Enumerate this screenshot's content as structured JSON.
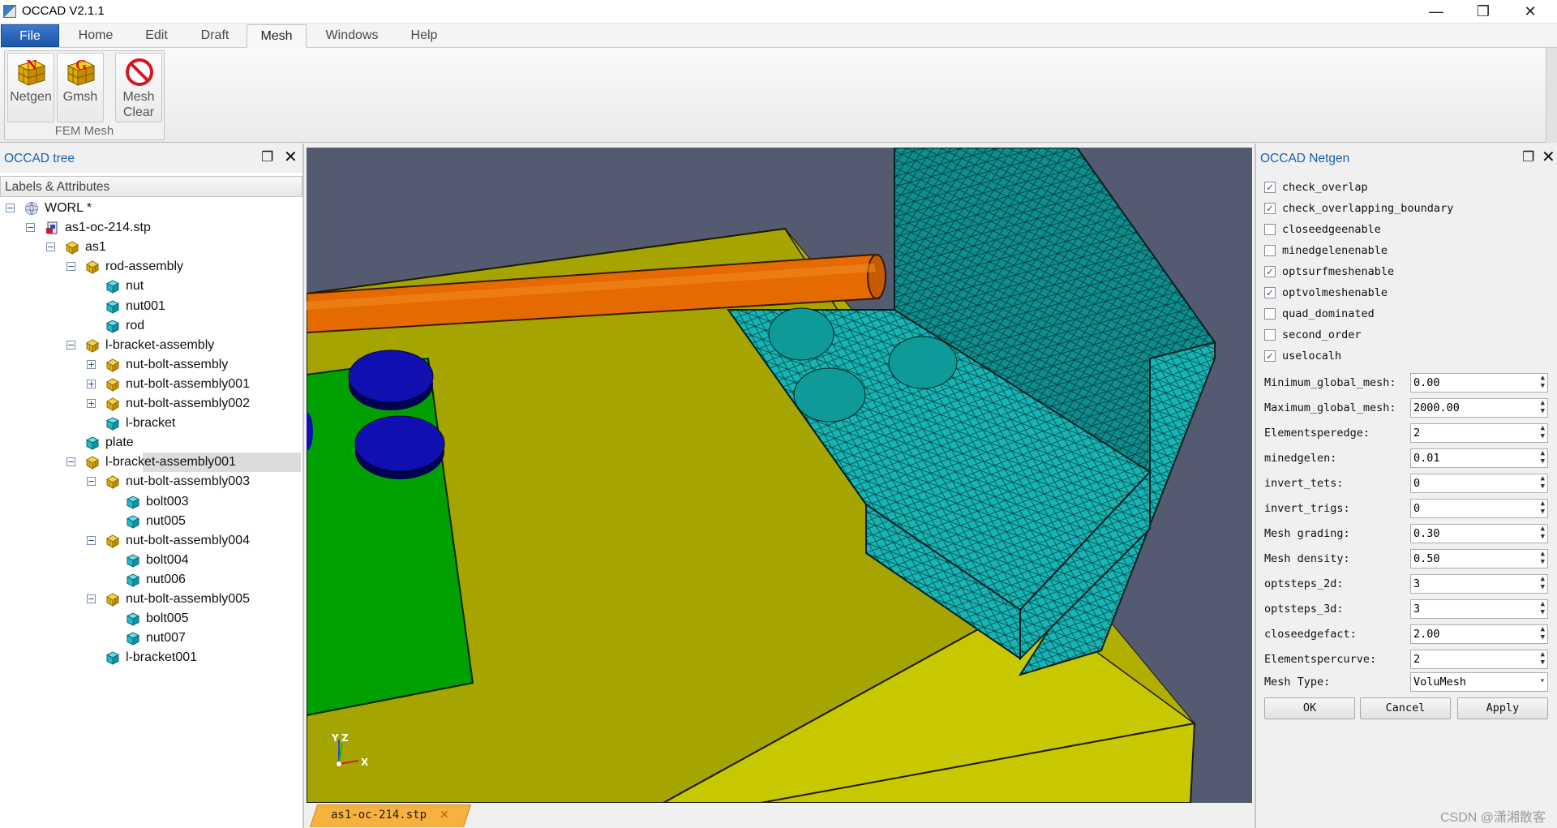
{
  "window": {
    "title": "OCCAD V2.1.1",
    "minimize": "—",
    "maximize": "❐",
    "close": "✕"
  },
  "menu": {
    "tabs": [
      "File",
      "Home",
      "Edit",
      "Draft",
      "Mesh",
      "Windows",
      "Help"
    ],
    "active": "Mesh",
    "collapse_glyph": "⌃"
  },
  "ribbon": {
    "group_label": "FEM Mesh",
    "buttons": [
      {
        "label": "Netgen",
        "icon": "netgen-icon"
      },
      {
        "label": "Gmsh",
        "icon": "gmsh-icon"
      },
      {
        "label": "Mesh\nClear",
        "icon": "mesh-clear-icon"
      }
    ]
  },
  "left_dock": {
    "title": "OCCAD tree",
    "header": "Labels & Attributes",
    "float_glyph": "❐",
    "close_glyph": "✕",
    "tree": [
      {
        "label": "WORL *",
        "level": 0,
        "toggle": "−",
        "icon": "world-icon"
      },
      {
        "label": "as1-oc-214.stp",
        "level": 1,
        "toggle": "−",
        "icon": "document-icon"
      },
      {
        "label": "as1",
        "level": 2,
        "toggle": "−",
        "icon": "assembly-icon"
      },
      {
        "label": "rod-assembly",
        "level": 3,
        "toggle": "−",
        "icon": "assembly-icon"
      },
      {
        "label": "nut",
        "level": 4,
        "toggle": "",
        "icon": "part-icon"
      },
      {
        "label": "nut001",
        "level": 4,
        "toggle": "",
        "icon": "part-icon"
      },
      {
        "label": "rod",
        "level": 4,
        "toggle": "",
        "icon": "part-icon"
      },
      {
        "label": "l-bracket-assembly",
        "level": 3,
        "toggle": "−",
        "icon": "assembly-icon"
      },
      {
        "label": "nut-bolt-assembly",
        "level": 4,
        "toggle": "+",
        "icon": "assembly-icon"
      },
      {
        "label": "nut-bolt-assembly001",
        "level": 4,
        "toggle": "+",
        "icon": "assembly-icon"
      },
      {
        "label": "nut-bolt-assembly002",
        "level": 4,
        "toggle": "+",
        "icon": "assembly-icon"
      },
      {
        "label": "l-bracket",
        "level": 4,
        "toggle": "",
        "icon": "part-icon"
      },
      {
        "label": "plate",
        "level": 3,
        "toggle": "",
        "icon": "part-icon"
      },
      {
        "label": "l-bracket-assembly001",
        "level": 3,
        "toggle": "−",
        "icon": "assembly-icon",
        "selected": true
      },
      {
        "label": "nut-bolt-assembly003",
        "level": 4,
        "toggle": "−",
        "icon": "assembly-icon"
      },
      {
        "label": "bolt003",
        "level": 5,
        "toggle": "",
        "icon": "part-icon"
      },
      {
        "label": "nut005",
        "level": 5,
        "toggle": "",
        "icon": "part-icon"
      },
      {
        "label": "nut-bolt-assembly004",
        "level": 4,
        "toggle": "−",
        "icon": "assembly-icon"
      },
      {
        "label": "bolt004",
        "level": 5,
        "toggle": "",
        "icon": "part-icon"
      },
      {
        "label": "nut006",
        "level": 5,
        "toggle": "",
        "icon": "part-icon"
      },
      {
        "label": "nut-bolt-assembly005",
        "level": 4,
        "toggle": "−",
        "icon": "assembly-icon"
      },
      {
        "label": "bolt005",
        "level": 5,
        "toggle": "",
        "icon": "part-icon"
      },
      {
        "label": "nut007",
        "level": 5,
        "toggle": "",
        "icon": "part-icon"
      },
      {
        "label": "l-bracket001",
        "level": 4,
        "toggle": "",
        "icon": "part-icon"
      }
    ]
  },
  "viewport": {
    "axes": {
      "x": "X",
      "y": "Y",
      "z": "Z"
    },
    "document_tab": "as1-oc-214.stp",
    "tab_close": "✕"
  },
  "right_dock": {
    "title": "OCCAD Netgen",
    "float_glyph": "❐",
    "close_glyph": "✕",
    "checkboxes": [
      {
        "label": "check_overlap",
        "checked": true
      },
      {
        "label": "check_overlapping_boundary",
        "checked": true
      },
      {
        "label": "closeedgeenable",
        "checked": false
      },
      {
        "label": "minedgelenenable",
        "checked": false
      },
      {
        "label": "optsurfmeshenable",
        "checked": true
      },
      {
        "label": "optvolmeshenable",
        "checked": true
      },
      {
        "label": "quad_dominated",
        "checked": false
      },
      {
        "label": "second_order",
        "checked": false
      },
      {
        "label": "uselocalh",
        "checked": true
      }
    ],
    "params": [
      {
        "label": "Minimum_global_mesh:",
        "value": "0.00"
      },
      {
        "label": "Maximum_global_mesh:",
        "value": "2000.00"
      },
      {
        "label": "Elementsperedge:",
        "value": "2"
      },
      {
        "label": "minedgelen:",
        "value": "0.01"
      },
      {
        "label": "invert_tets:",
        "value": "0"
      },
      {
        "label": "invert_trigs:",
        "value": "0"
      },
      {
        "label": "Mesh grading:",
        "value": "0.30"
      },
      {
        "label": "Mesh density:",
        "value": "0.50"
      },
      {
        "label": "optsteps_2d:",
        "value": "3"
      },
      {
        "label": "optsteps_3d:",
        "value": "3"
      },
      {
        "label": "closeedgefact:",
        "value": "2.00"
      },
      {
        "label": "Elementspercurve:",
        "value": "2"
      }
    ],
    "mesh_type": {
      "label": "Mesh Type:",
      "value": "VoluMesh"
    },
    "buttons": {
      "ok": "OK",
      "cancel": "Cancel",
      "apply": "Apply"
    }
  },
  "watermark": "CSDN @潇湘散客",
  "colors": {
    "accent": "#1b5fb4",
    "viewport_bg": "#545a70",
    "plate": "#a5a400",
    "bracket_green": "#00a000",
    "mesh": "#16b5b5",
    "rod": "#e56a00",
    "bolt": "#1010b0",
    "doc_tab": "#f6b13e"
  }
}
